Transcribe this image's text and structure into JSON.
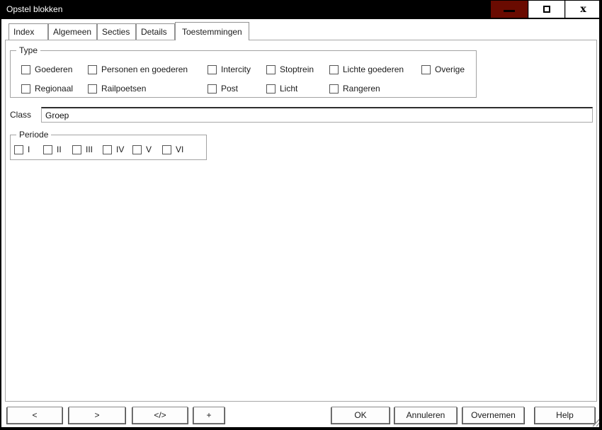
{
  "window": {
    "title": "Opstel blokken"
  },
  "titlebar": {
    "close_glyph": "x"
  },
  "colors": {
    "titlebar_bg": "#000000",
    "titlebar_text": "#ffffff",
    "minimize_button_bg": "#6a0b01",
    "group_border": "#a3a3a3",
    "button_shadow": "#4f4f4f"
  },
  "tabs": [
    {
      "label": "Index",
      "active": false
    },
    {
      "label": "Algemeen",
      "active": false
    },
    {
      "label": "Secties",
      "active": false
    },
    {
      "label": "Details",
      "active": false
    },
    {
      "label": "Toestemmingen",
      "active": true
    }
  ],
  "type_group": {
    "label": "Type",
    "items": [
      {
        "label": "Goederen",
        "checked": false
      },
      {
        "label": "Personen en goederen",
        "checked": false
      },
      {
        "label": "Intercity",
        "checked": false
      },
      {
        "label": "Stoptrein",
        "checked": false
      },
      {
        "label": "Lichte goederen",
        "checked": false
      },
      {
        "label": "Overige",
        "checked": false
      },
      {
        "label": "Regionaal",
        "checked": false
      },
      {
        "label": "Railpoetsen",
        "checked": false
      },
      {
        "label": "Post",
        "checked": false
      },
      {
        "label": "Licht",
        "checked": false
      },
      {
        "label": "Rangeren",
        "checked": false
      }
    ]
  },
  "class_field": {
    "label": "Class",
    "value": "Groep"
  },
  "periode_group": {
    "label": "Periode",
    "items": [
      {
        "label": "I",
        "checked": false
      },
      {
        "label": "II",
        "checked": false
      },
      {
        "label": "III",
        "checked": false
      },
      {
        "label": "IV",
        "checked": false
      },
      {
        "label": "V",
        "checked": false
      },
      {
        "label": "VI",
        "checked": false
      }
    ]
  },
  "nav_buttons": [
    {
      "label": "<"
    },
    {
      "label": ">"
    },
    {
      "label": "</>"
    },
    {
      "label": "+"
    }
  ],
  "action_buttons": [
    {
      "label": "OK"
    },
    {
      "label": "Annuleren"
    },
    {
      "label": "Overnemen"
    },
    {
      "label": "Help"
    }
  ]
}
